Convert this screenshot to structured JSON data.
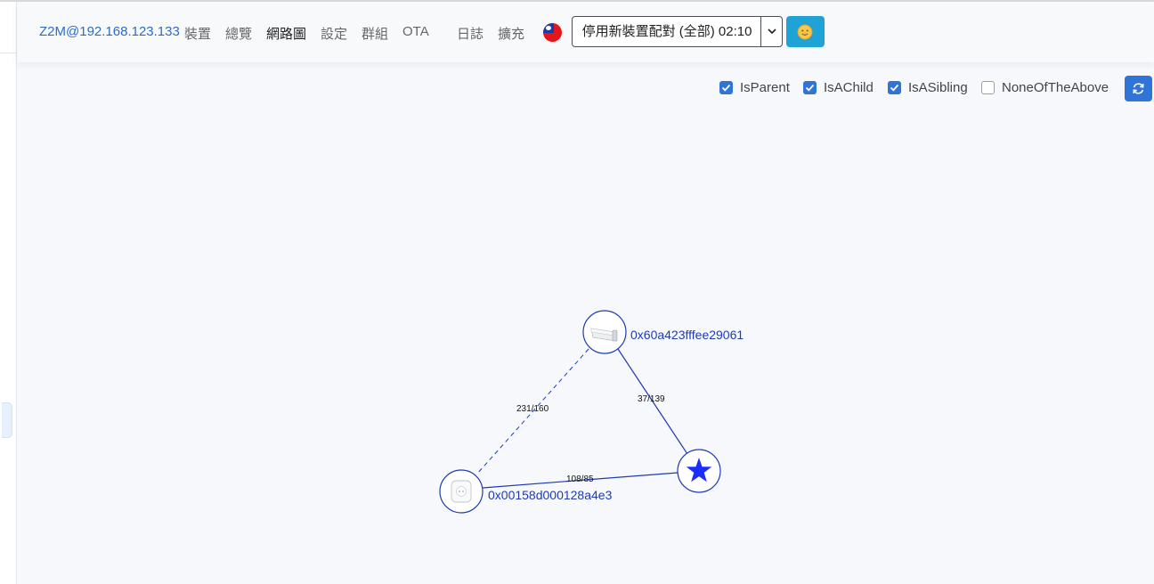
{
  "nav": {
    "brand": "Z2M@192.168.123.133",
    "links": [
      "裝置",
      "總覽",
      "網路圖",
      "設定",
      "群組",
      "OTA",
      "日誌",
      "擴充"
    ],
    "active": "網路圖",
    "language_flag": "taiwan-flag-icon",
    "permit_join_label": "停用新裝置配對 (全部) 02:10",
    "theme_icon": "sun-icon"
  },
  "filters": [
    {
      "label": "IsParent",
      "checked": true
    },
    {
      "label": "IsAChild",
      "checked": true
    },
    {
      "label": "IsASibling",
      "checked": true
    },
    {
      "label": "NoneOfTheAbove",
      "checked": false
    }
  ],
  "refresh_icon": "refresh-icon",
  "network": {
    "nodes": [
      {
        "id": "router",
        "label": "0x60a423fffee29061",
        "icon": "light-strip-icon"
      },
      {
        "id": "plug",
        "label": "0x00158d000128a4e3",
        "icon": "smart-plug-icon"
      },
      {
        "id": "coordinator",
        "label": "",
        "icon": "star-icon"
      }
    ],
    "links": [
      {
        "from": "router",
        "to": "plug",
        "label": "231/160",
        "style": "dashed"
      },
      {
        "from": "router",
        "to": "coordinator",
        "label": "37/139",
        "style": "solid"
      },
      {
        "from": "plug",
        "to": "coordinator",
        "label": "108/85",
        "style": "solid"
      }
    ]
  },
  "colors": {
    "accent": "#2f74d6",
    "graph": "#1f3bb3",
    "theme_button": "#1fa2d6"
  }
}
